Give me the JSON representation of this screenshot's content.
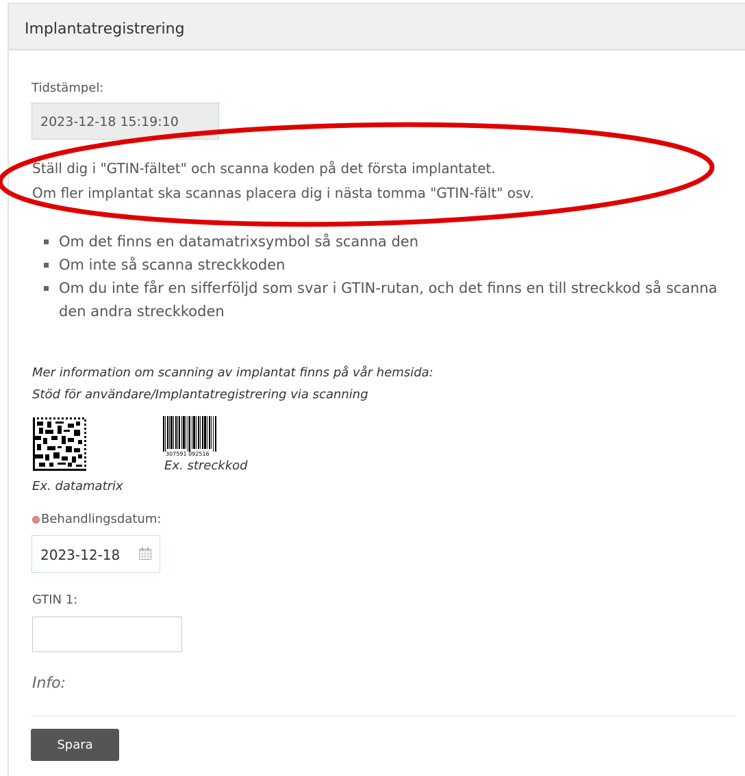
{
  "panel": {
    "title": "Implantatregistrering"
  },
  "timestamp": {
    "label": "Tidstämpel:",
    "value": "2023-12-18 15:19:10"
  },
  "instructions": {
    "line1": "Ställ dig i \"GTIN-fältet\" och scanna koden på det första implantatet.",
    "line2": "Om fler implantat ska scannas placera dig i nästa tomma \"GTIN-fält\" osv."
  },
  "tips": [
    "Om det finns en datamatrixsymbol så scanna den",
    "Om inte så scanna streckkoden",
    "Om du inte får en sifferföljd som svar i GTIN-rutan, och det finns en till streckkod så scanna den andra streckkoden"
  ],
  "more_info": {
    "line1": "Mer information om scanning av implantat finns på vår hemsida:",
    "line2": "Stöd för användare/Implantatregistrering via scanning"
  },
  "examples": {
    "datamatrix_caption": "Ex. datamatrix",
    "barcode_caption": "Ex. streckkod",
    "barcode_digits": "307591 092516"
  },
  "treatment_date": {
    "label": "Behandlingsdatum:",
    "value": "2023-12-18"
  },
  "gtin": {
    "label": "GTIN 1:",
    "value": ""
  },
  "info": {
    "label": "Info:"
  },
  "actions": {
    "save_label": "Spara"
  },
  "colors": {
    "annotation_red": "#e00000",
    "field_border": "#8bd08b",
    "button_bg": "#555555"
  },
  "icons": {
    "date_picker": "calendar-icon",
    "required_marker": "required-dot-icon"
  }
}
